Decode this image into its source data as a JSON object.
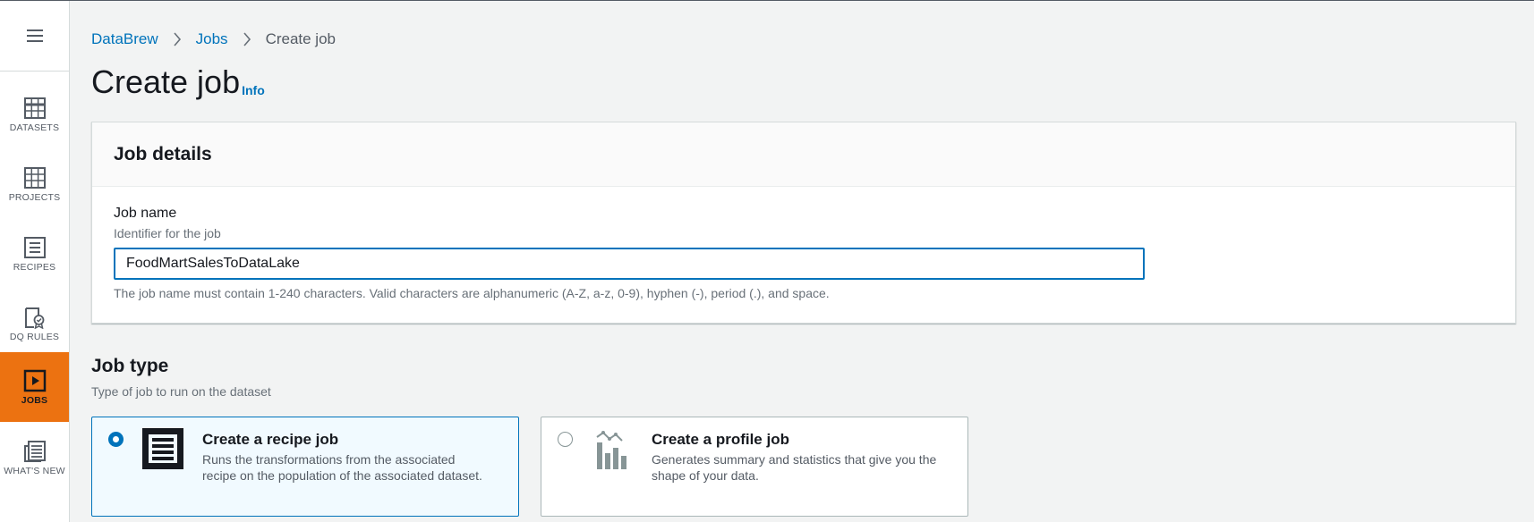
{
  "sidebar": {
    "menu_icon": "hamburger-menu-icon",
    "items": [
      {
        "label": "DATASETS",
        "icon": "datasets-grid-icon",
        "active": false
      },
      {
        "label": "PROJECTS",
        "icon": "projects-grid-icon",
        "active": false
      },
      {
        "label": "RECIPES",
        "icon": "recipes-list-icon",
        "active": false
      },
      {
        "label": "DQ RULES",
        "icon": "dq-rules-badge-icon",
        "active": false
      },
      {
        "label": "JOBS",
        "icon": "jobs-play-icon",
        "active": true
      },
      {
        "label": "WHAT'S NEW",
        "icon": "whats-new-newspaper-icon",
        "active": false
      }
    ],
    "active_color": "#ec7211"
  },
  "breadcrumb": {
    "items": [
      {
        "label": "DataBrew",
        "link": true
      },
      {
        "label": "Jobs",
        "link": true
      },
      {
        "label": "Create job",
        "link": false
      }
    ]
  },
  "page": {
    "title": "Create job",
    "info_label": "Info"
  },
  "job_details": {
    "title": "Job details",
    "job_name_label": "Job name",
    "job_name_description": "Identifier for the job",
    "job_name_value": "FoodMartSalesToDataLake",
    "job_name_constraint": "The job name must contain 1-240 characters. Valid characters are alphanumeric (A-Z, a-z, 0-9), hyphen (-), period (.), and space."
  },
  "job_type": {
    "title": "Job type",
    "description": "Type of job to run on the dataset",
    "options": [
      {
        "title": "Create a recipe job",
        "description": "Runs the transformations from the associated recipe on the population of the associated dataset.",
        "icon": "recipe-list-icon",
        "selected": true
      },
      {
        "title": "Create a profile job",
        "description": "Generates summary and statistics that give you the shape of your data.",
        "icon": "profile-chart-icon",
        "selected": false
      }
    ]
  },
  "colors": {
    "link": "#0073bb",
    "accent": "#ec7211",
    "selected_tile_bg": "#f1faff"
  }
}
